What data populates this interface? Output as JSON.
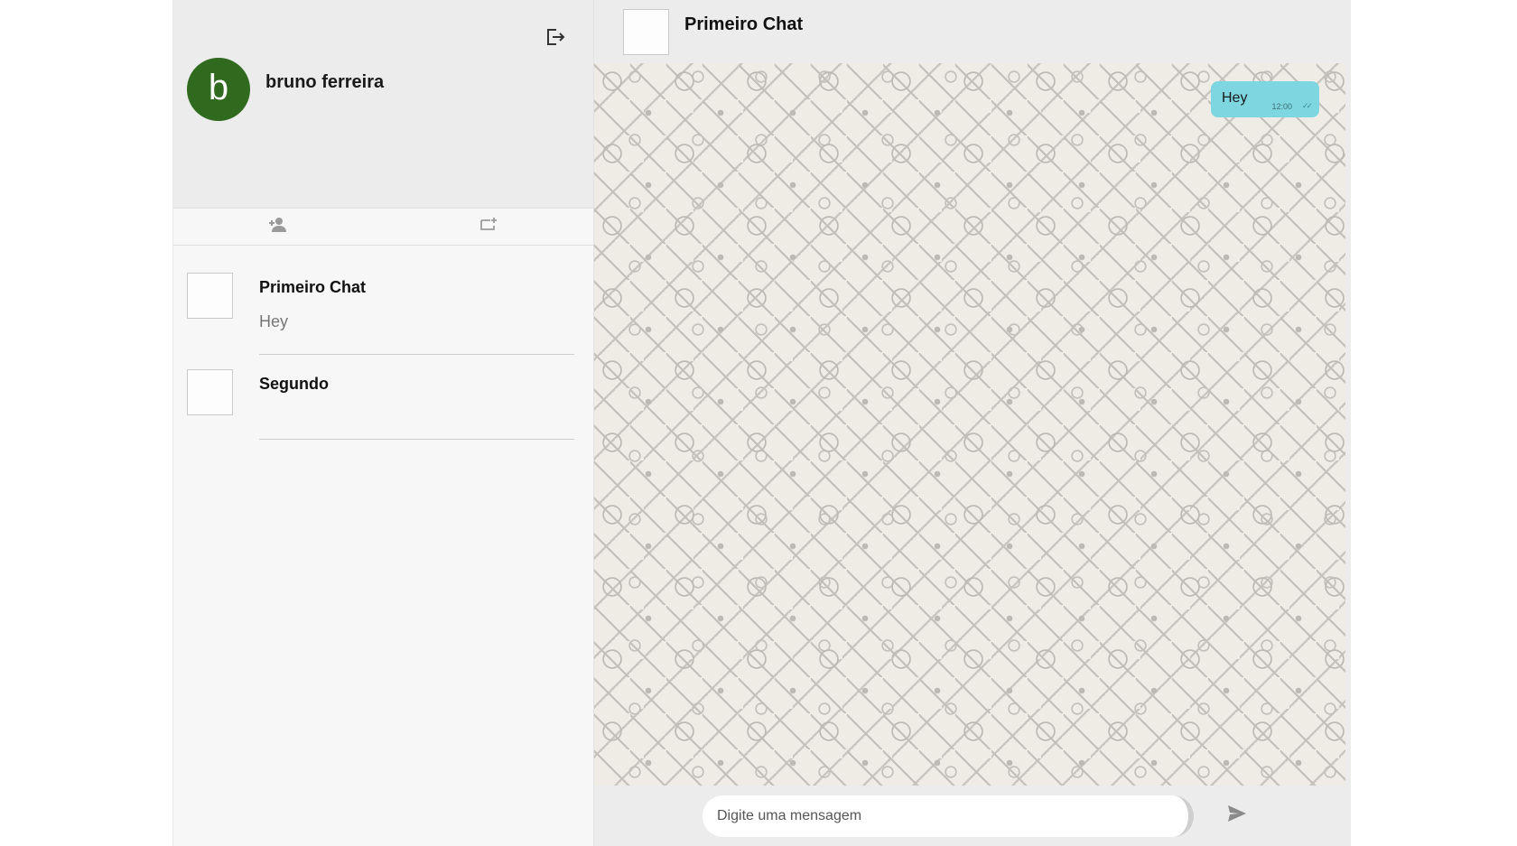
{
  "profile": {
    "avatar_letter": "b",
    "name": "bruno ferreira",
    "avatar_color": "#2f6a1f"
  },
  "icons": {
    "logout": "logout-icon",
    "contacts": "person-add-icon",
    "new_chat": "new-chat-icon",
    "send": "send-icon"
  },
  "chats": [
    {
      "title": "Primeiro Chat",
      "last_message": "Hey"
    },
    {
      "title": "Segundo",
      "last_message": ""
    }
  ],
  "active_chat": {
    "title": "Primeiro Chat",
    "messages": [
      {
        "text": "Hey",
        "time": "12:00",
        "status": "✓✓"
      }
    ]
  },
  "composer": {
    "placeholder": "Digite uma mensagem",
    "value": ""
  },
  "colors": {
    "bubble": "#7ed6e0",
    "header_bg": "#ececec"
  }
}
